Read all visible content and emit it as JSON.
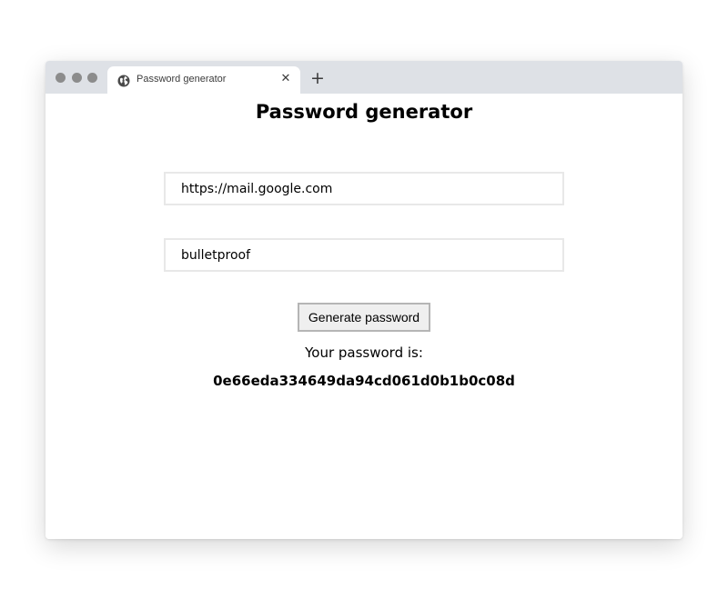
{
  "browser": {
    "tab": {
      "icon": "globe-icon",
      "title": "Password generator",
      "close_glyph": "✕"
    },
    "new_tab_glyph": "+"
  },
  "page": {
    "title": "Password generator",
    "url_field": {
      "value": "https://mail.google.com",
      "placeholder": ""
    },
    "secret_field": {
      "value": "bulletproof",
      "placeholder": ""
    },
    "generate_button_label": "Generate password",
    "result_label": "Your password is:",
    "result_value": "0e66eda334649da94cd061d0b1b0c08d"
  },
  "colors": {
    "titlebar": "#dee1e6",
    "traffic_dots": "#8c8c8c",
    "button_bg": "#efefef",
    "button_border": "#b5b5b5",
    "field_border": "#e8e8e8"
  }
}
